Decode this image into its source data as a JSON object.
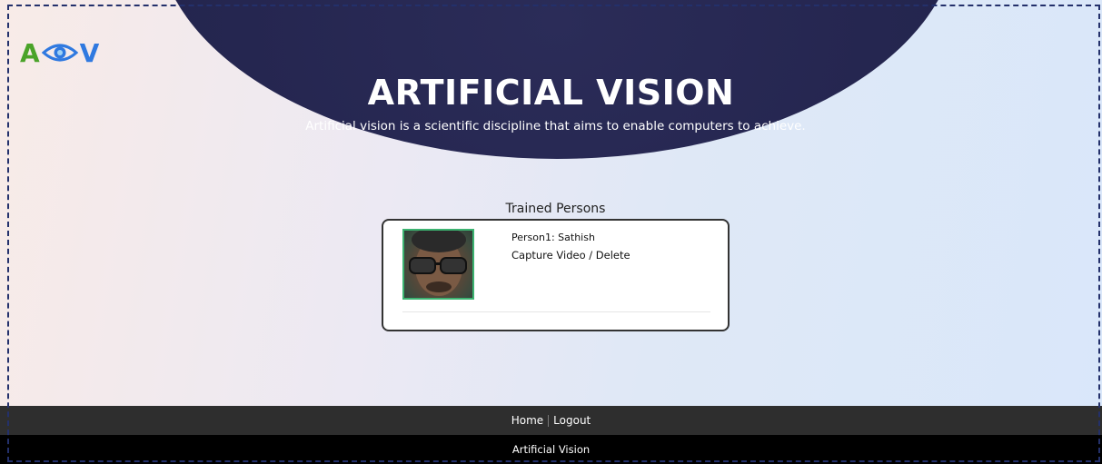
{
  "brand": {
    "logo_left": "A",
    "logo_right": "V",
    "colors": {
      "green": "#4aa329",
      "blue": "#2f79e0"
    },
    "icon": "eye-icon"
  },
  "hero": {
    "title": "ARTIFICIAL VISION",
    "subtitle": "Artificial vision is a scientific discipline that aims to enable computers to achieve.",
    "background_color": "#252650"
  },
  "trained": {
    "heading": "Trained Persons",
    "persons": [
      {
        "name_label": "Person1: Sathish",
        "capture_label": "Capture Video",
        "separator": "/",
        "delete_label": "Delete"
      }
    ]
  },
  "nav": {
    "home_label": "Home",
    "logout_label": "Logout"
  },
  "footer": {
    "text": "Artificial Vision"
  }
}
